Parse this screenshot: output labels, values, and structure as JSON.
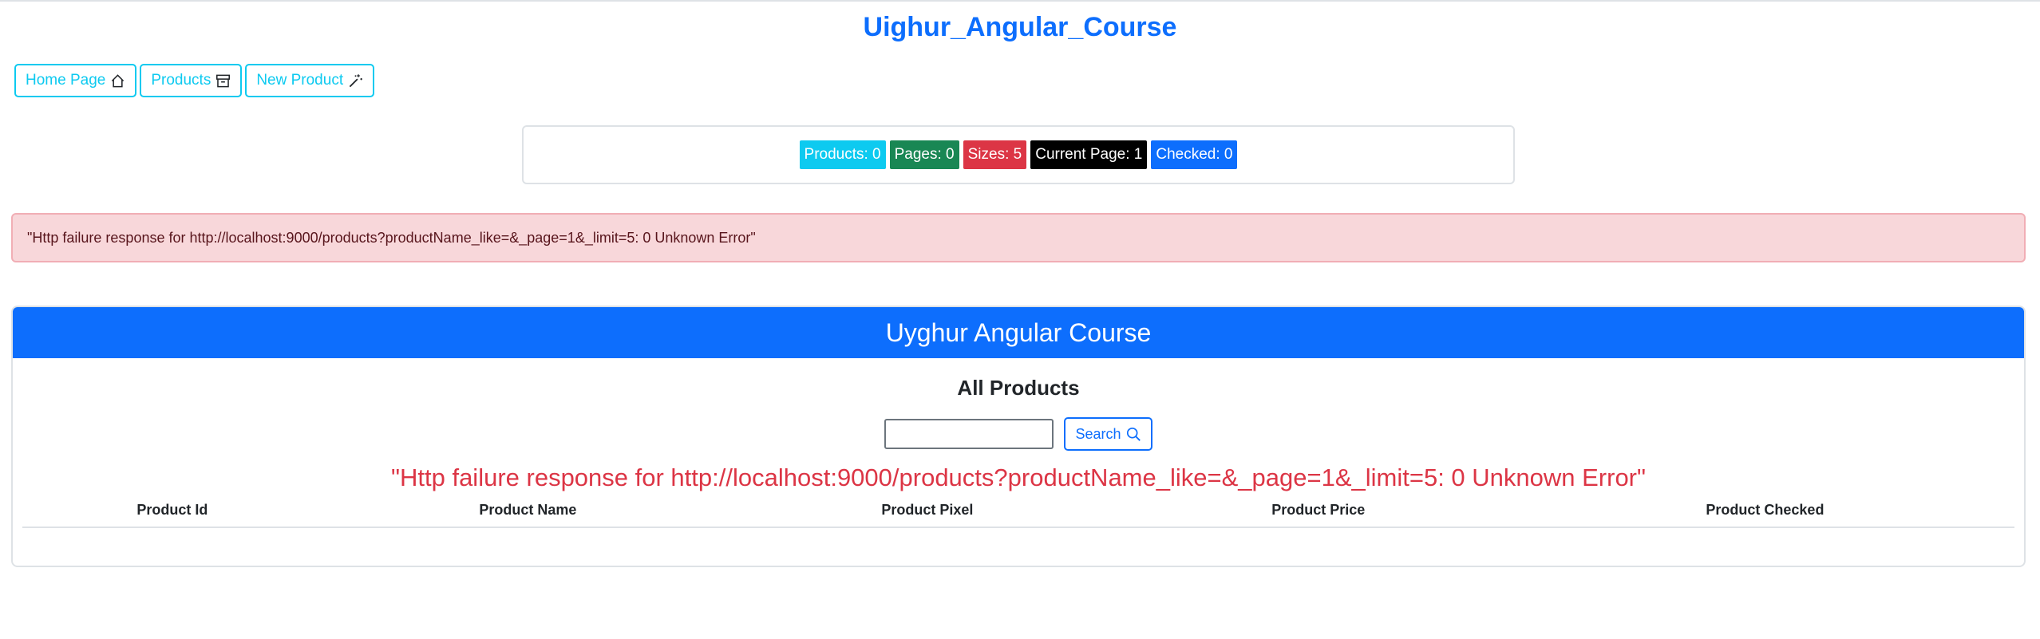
{
  "app": {
    "title": "Uighur_Angular_Course"
  },
  "nav": {
    "items": [
      {
        "label": "Home Page",
        "icon": "house-icon"
      },
      {
        "label": "Products",
        "icon": "archive-icon"
      },
      {
        "label": "New Product",
        "icon": "magic-wand-icon"
      }
    ]
  },
  "stats": {
    "products": "Products: 0",
    "pages": "Pages: 0",
    "sizes": "Sizes: 5",
    "current_page": "Current Page: 1",
    "checked": "Checked: 0"
  },
  "alert": {
    "message": "\"Http failure response for http://localhost:9000/products?productName_like=&_page=1&_limit=5: 0 Unknown Error\""
  },
  "card": {
    "header": "Uyghur Angular Course",
    "subtitle": "All Products",
    "search": {
      "value": "",
      "placeholder": "",
      "button_label": "Search",
      "button_icon": "search-icon"
    },
    "error": "\"Http failure response for http://localhost:9000/products?productName_like=&_page=1&_limit=5: 0 Unknown Error\"",
    "table": {
      "columns": [
        "Product Id",
        "Product Name",
        "Product Pixel",
        "Product Price",
        "Product Checked"
      ],
      "rows": []
    }
  },
  "colors": {
    "primary": "#0d6efd",
    "info": "#0dcaf0",
    "success": "#198754",
    "danger": "#dc3545",
    "dark": "#000000",
    "alert_bg": "#f8d7da"
  }
}
